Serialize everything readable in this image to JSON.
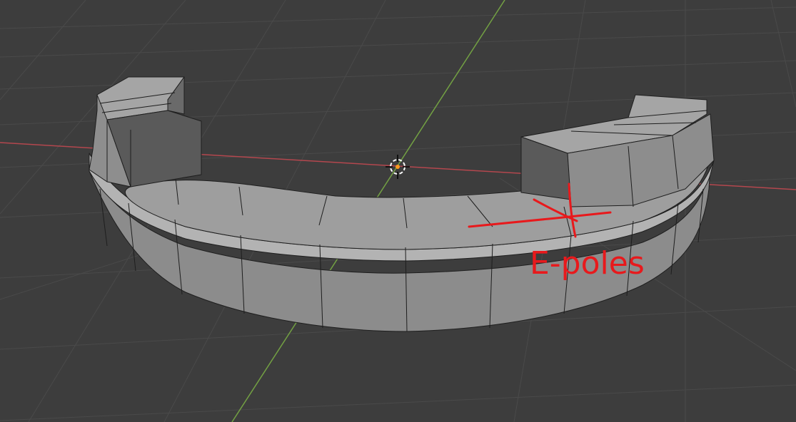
{
  "viewport": {
    "background": "#3d3d3d",
    "grid_color": "#4a4a4a",
    "x_axis_color": "#b4474e",
    "y_axis_color": "#73a143"
  },
  "mesh": {
    "face_light": "#b8b8b8",
    "face_mid": "#8d8d8d",
    "face_dark": "#5a5a5a",
    "edge_color": "#1e1e1e"
  },
  "annotation": {
    "color": "#e8191c",
    "text": "E-poles"
  }
}
